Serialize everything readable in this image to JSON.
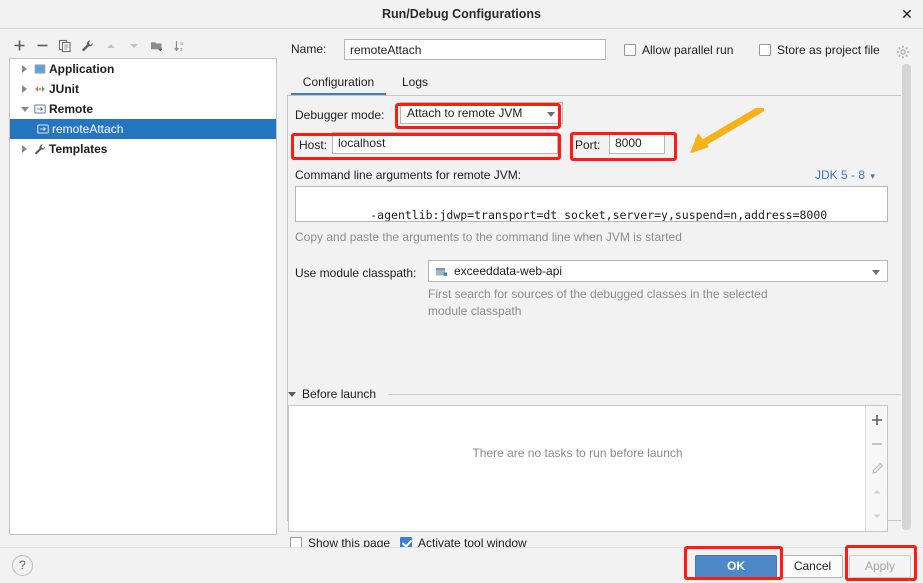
{
  "window": {
    "title": "Run/Debug Configurations",
    "close_label": "✕"
  },
  "sidebar": {
    "toolbar": [
      {
        "name": "add-icon",
        "glyph": "+"
      },
      {
        "name": "remove-icon",
        "glyph": "−"
      },
      {
        "name": "copy-icon",
        "glyph": "copy"
      },
      {
        "name": "edit-templates-icon",
        "glyph": "wrench"
      },
      {
        "name": "move-up-icon",
        "glyph": "up"
      },
      {
        "name": "move-down-icon",
        "glyph": "down"
      },
      {
        "name": "new-folder-icon",
        "glyph": "folder"
      },
      {
        "name": "sort-alphabetically-icon",
        "glyph": "sort"
      }
    ],
    "tree": [
      {
        "label": "Application",
        "icon": "application-icon",
        "state": "closed",
        "depth": 0,
        "selected": false
      },
      {
        "label": "JUnit",
        "icon": "junit-icon",
        "state": "closed",
        "depth": 0,
        "selected": false
      },
      {
        "label": "Remote",
        "icon": "remote-icon",
        "state": "open",
        "depth": 0,
        "selected": false
      },
      {
        "label": "remoteAttach",
        "icon": "remote-config-icon",
        "state": "leaf",
        "depth": 1,
        "selected": true
      },
      {
        "label": "Templates",
        "icon": "templates-icon",
        "state": "closed",
        "depth": 0,
        "selected": false
      }
    ]
  },
  "main": {
    "name_label": "Name:",
    "name_value": "remoteAttach",
    "allow_parallel_run": {
      "label": "Allow parallel run",
      "checked": false
    },
    "store_as_project_file": {
      "label": "Store as project file",
      "checked": false
    },
    "gear_icon": "gear-icon",
    "tabs": [
      {
        "label": "Configuration",
        "active": true
      },
      {
        "label": "Logs",
        "active": false
      }
    ],
    "debugger_mode": {
      "label": "Debugger mode:",
      "value": "Attach to remote JVM"
    },
    "host": {
      "label": "Host:",
      "value": "localhost"
    },
    "port": {
      "label": "Port:",
      "value": "8000"
    },
    "command_line": {
      "label": "Command line arguments for remote JVM:",
      "value": "-agentlib:jdwp=transport=dt_socket,server=y,suspend=n,address=8000",
      "hint": "Copy and paste the arguments to the command line when JVM is started",
      "jdk_selector": "JDK 5 - 8"
    },
    "module_classpath": {
      "label": "Use module classpath:",
      "value": "exceeddata-web-api",
      "icon": "module-icon",
      "hint_line1": "First search for sources of the debugged classes in the selected",
      "hint_line2": "module classpath"
    },
    "before_launch": {
      "title": "Before launch",
      "empty_text": "There are no tasks to run before launch",
      "buttons": [
        {
          "name": "add-task-icon",
          "glyph": "+"
        },
        {
          "name": "remove-task-icon",
          "glyph": "−"
        },
        {
          "name": "edit-task-icon",
          "glyph": "pencil"
        },
        {
          "name": "move-task-up-icon",
          "glyph": "up"
        },
        {
          "name": "move-task-down-icon",
          "glyph": "down"
        }
      ]
    },
    "bottom_checks": {
      "show_this_page": {
        "label": "Show this page",
        "checked": false
      },
      "activate_tool_window": {
        "label": "Activate tool window",
        "checked": true
      }
    }
  },
  "footer": {
    "help_label": "?",
    "ok_label": "OK",
    "cancel_label": "Cancel",
    "apply_label": "Apply"
  },
  "annotations": {
    "highlight_color": "#fc1d10",
    "arrow_color": "#f7b219",
    "boxes": [
      "debugger-mode-combo",
      "host-field-row",
      "port-field-row",
      "ok-button",
      "apply-button"
    ]
  }
}
